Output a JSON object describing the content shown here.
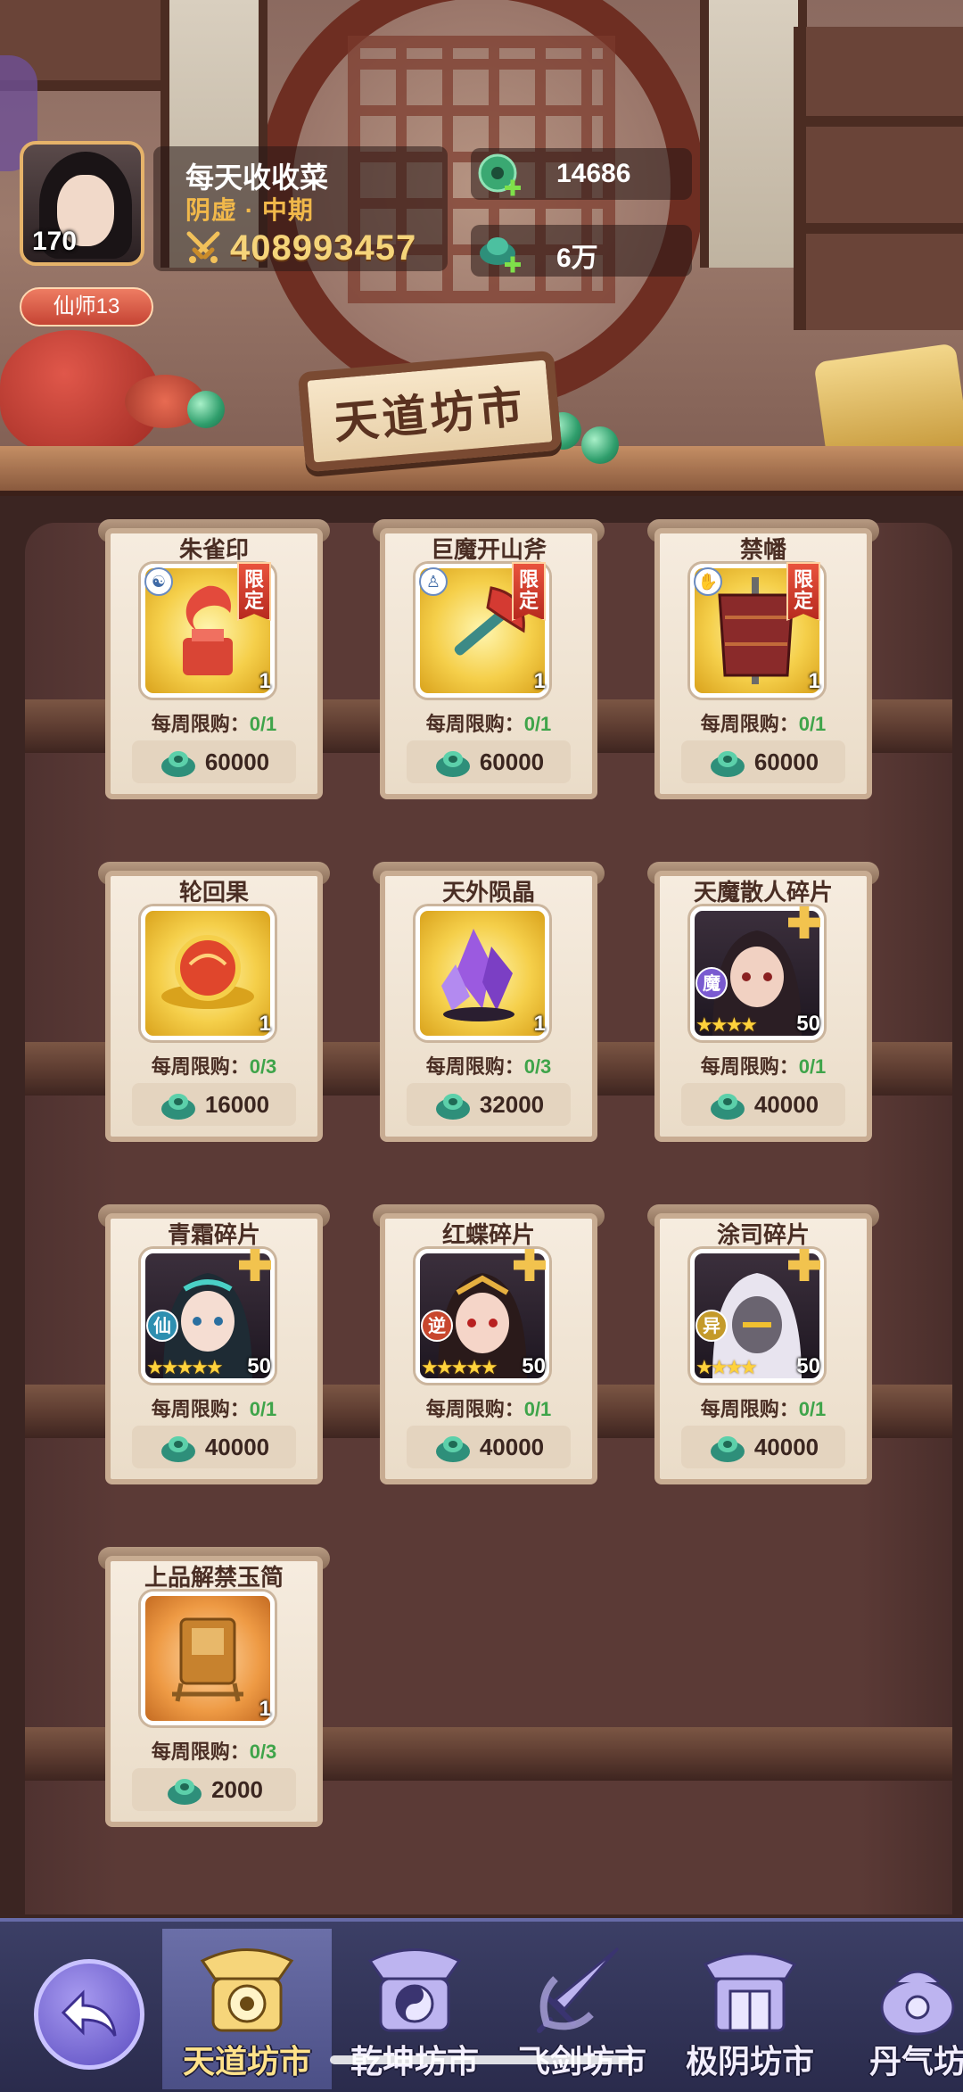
{
  "player": {
    "name": "每天收收菜",
    "realm": "阴虚 · 中期",
    "level": "170",
    "power": "408993457",
    "title_badge": "仙师13"
  },
  "currencies": [
    {
      "icon": "jade-coin-icon",
      "amount": "14686"
    },
    {
      "icon": "jade-ingot-icon",
      "amount": "6万"
    }
  ],
  "shop_title": "天道坊市",
  "limit_label": "每周限购：",
  "items": [
    {
      "name": "朱雀印",
      "qty": "1",
      "limited": "限定",
      "limit": "0/1",
      "price": "60000",
      "art": "vermilion-seal",
      "type_icon": "yin-yang-icon"
    },
    {
      "name": "巨魔开山斧",
      "qty": "1",
      "limited": "限定",
      "limit": "0/1",
      "price": "60000",
      "art": "giant-axe",
      "type_icon": "person-icon"
    },
    {
      "name": "禁幡",
      "qty": "1",
      "limited": "限定",
      "limit": "0/1",
      "price": "60000",
      "art": "forbidden-banner",
      "type_icon": "hand-icon"
    },
    {
      "name": "轮回果",
      "qty": "1",
      "limit": "0/3",
      "price": "16000",
      "art": "samsara-fruit"
    },
    {
      "name": "天外陨晶",
      "qty": "1",
      "limit": "0/3",
      "price": "32000",
      "art": "meteor-crystal"
    },
    {
      "name": "天魔散人碎片",
      "qty": "50",
      "limit": "0/1",
      "price": "40000",
      "art": "hero-demon",
      "faction": "魔",
      "stars": "★★★★"
    },
    {
      "name": "青霜碎片",
      "qty": "50",
      "limit": "0/1",
      "price": "40000",
      "art": "hero-qingshuang",
      "faction": "仙",
      "stars": "★★★★★"
    },
    {
      "name": "红蝶碎片",
      "qty": "50",
      "limit": "0/1",
      "price": "40000",
      "art": "hero-hongdie",
      "faction": "逆",
      "stars": "★★★★★"
    },
    {
      "name": "涂司碎片",
      "qty": "50",
      "limit": "0/1",
      "price": "40000",
      "art": "hero-tusi",
      "faction": "异",
      "stars": "★★★★"
    },
    {
      "name": "上品解禁玉简",
      "qty": "1",
      "limit": "0/3",
      "price": "2000",
      "art": "jade-slip"
    }
  ],
  "tabs": [
    {
      "label": "天道坊市",
      "active": true
    },
    {
      "label": "乾坤坊市",
      "active": false
    },
    {
      "label": "飞剑坊市",
      "active": false
    },
    {
      "label": "极阴坊市",
      "active": false
    },
    {
      "label": "丹气坊",
      "active": false
    }
  ],
  "colors": {
    "limit_value": "#3fa44a",
    "realm": "#f1b84a",
    "power": "#f5d47a",
    "active_tab": "#ffe28a"
  }
}
